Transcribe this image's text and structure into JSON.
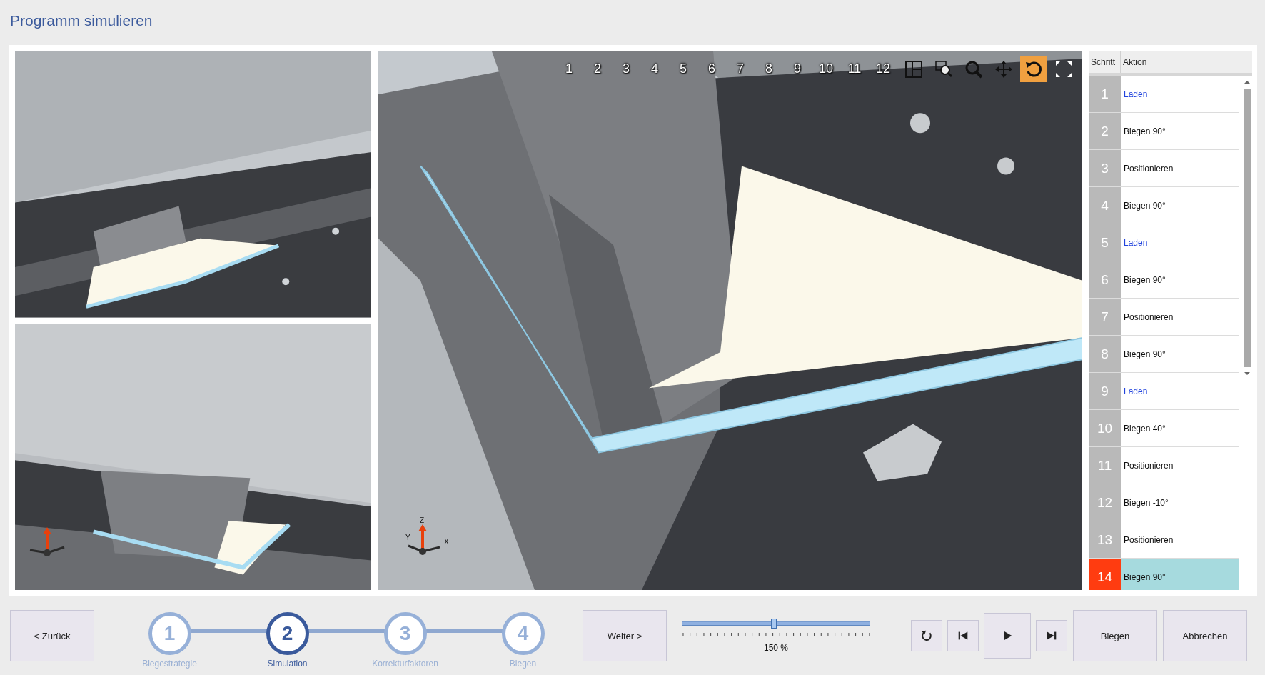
{
  "window": {
    "title": "Programm simulieren"
  },
  "viewer": {
    "step_buttons": [
      "1",
      "2",
      "3",
      "4",
      "5",
      "6",
      "7",
      "8",
      "9",
      "10",
      "11",
      "12"
    ],
    "tools": [
      {
        "kind": "layout",
        "selected": false
      },
      {
        "kind": "zoom-window",
        "selected": false
      },
      {
        "kind": "zoom",
        "selected": false
      },
      {
        "kind": "pan",
        "selected": false
      },
      {
        "kind": "rotate",
        "selected": true
      },
      {
        "kind": "fit",
        "selected": false
      }
    ],
    "axes": {
      "z": "Z",
      "y": "Y",
      "x": "X"
    }
  },
  "steps_table": {
    "columns": [
      "Schritt",
      "Aktion"
    ],
    "rows": [
      {
        "step": "1",
        "action": "Laden",
        "kind": "load",
        "selected": false
      },
      {
        "step": "2",
        "action": "Biegen 90°",
        "kind": "bend",
        "selected": false
      },
      {
        "step": "3",
        "action": "Positionieren",
        "kind": "position",
        "selected": false
      },
      {
        "step": "4",
        "action": "Biegen 90°",
        "kind": "bend",
        "selected": false
      },
      {
        "step": "5",
        "action": "Laden",
        "kind": "load",
        "selected": false
      },
      {
        "step": "6",
        "action": "Biegen 90°",
        "kind": "bend",
        "selected": false
      },
      {
        "step": "7",
        "action": "Positionieren",
        "kind": "position",
        "selected": false
      },
      {
        "step": "8",
        "action": "Biegen 90°",
        "kind": "bend",
        "selected": false
      },
      {
        "step": "9",
        "action": "Laden",
        "kind": "load",
        "selected": false
      },
      {
        "step": "10",
        "action": "Biegen 40°",
        "kind": "bend",
        "selected": false
      },
      {
        "step": "11",
        "action": "Positionieren",
        "kind": "position",
        "selected": false
      },
      {
        "step": "12",
        "action": "Biegen -10°",
        "kind": "bend",
        "selected": false
      },
      {
        "step": "13",
        "action": "Positionieren",
        "kind": "position",
        "selected": false
      },
      {
        "step": "14",
        "action": "Biegen 90°",
        "kind": "bend",
        "selected": true
      }
    ]
  },
  "back_button": "< Zurück",
  "wizard": [
    {
      "number": "1",
      "label": "Biegestrategie",
      "selected": false
    },
    {
      "number": "2",
      "label": "Simulation",
      "selected": true
    },
    {
      "number": "3",
      "label": "Korrekturfaktoren",
      "selected": false
    },
    {
      "number": "4",
      "label": "Biegen",
      "selected": false
    }
  ],
  "next_button": "Weiter >",
  "speed_slider": {
    "level": 0.49,
    "reading": "150 %"
  },
  "playback": [
    {
      "kind": "repeat"
    },
    {
      "kind": "first"
    },
    {
      "kind": "play"
    },
    {
      "kind": "last"
    }
  ],
  "buttons": [
    "Biegen",
    "Abbrechen"
  ]
}
